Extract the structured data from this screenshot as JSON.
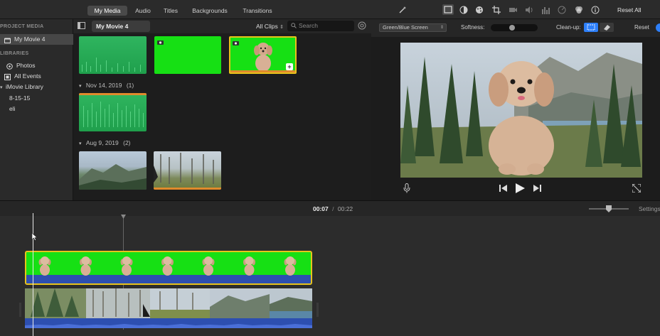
{
  "tabs": {
    "my_media": "My Media",
    "audio": "Audio",
    "titles": "Titles",
    "backgrounds": "Backgrounds",
    "transitions": "Transitions"
  },
  "sidebar": {
    "project_media_header": "PROJECT MEDIA",
    "project_item": "My Movie 4",
    "libraries_header": "LIBRARIES",
    "photos": "Photos",
    "all_events": "All Events",
    "imovie_library": "iMovie Library",
    "event_1": "8-15-15",
    "event_2": "eli"
  },
  "browser": {
    "title": "My Movie 4",
    "filter": "All Clips",
    "search_placeholder": "Search",
    "group1_date": "Nov 14, 2019",
    "group1_count": "(1)",
    "group2_date": "Aug 9, 2019",
    "group2_count": "(2)"
  },
  "viewer_toolbar": {
    "reset_all": "Reset All"
  },
  "viewer_controls": {
    "effect_select": "Green/Blue Screen",
    "softness_label": "Softness:",
    "softness_value": 0.45,
    "cleanup_label": "Clean-up:",
    "reset": "Reset"
  },
  "timeline": {
    "current_time": "00:07",
    "separator": "/",
    "total_time": "00:22",
    "settings": "Settings"
  },
  "colors": {
    "green_screen": "#16e014",
    "accent_blue": "#2d7ff9",
    "audio_blue": "#2d4fb0",
    "selection_yellow": "#e8c21c"
  }
}
